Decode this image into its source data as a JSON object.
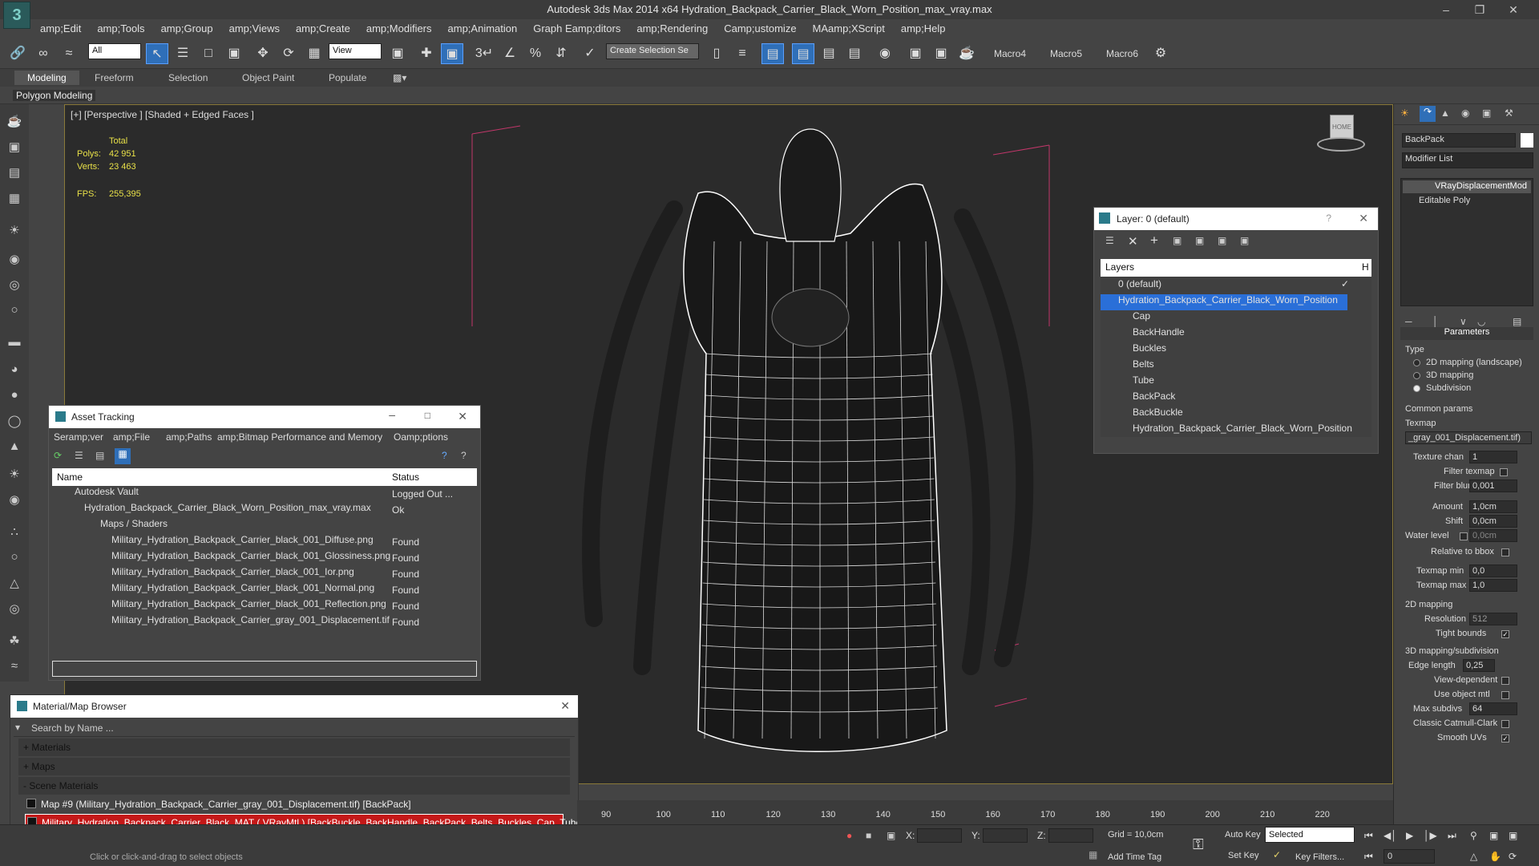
{
  "window": {
    "title": "Autodesk 3ds Max  2014 x64     Hydration_Backpack_Carrier_Black_Worn_Position_max_vray.max",
    "logo_icon": "3dsmax-logo-icon"
  },
  "menu": [
    "amp;Edit",
    "amp;Tools",
    "amp;Group",
    "amp;Views",
    "amp;Create",
    "amp;Modifiers",
    "amp;Animation",
    "Graph Eamp;ditors",
    "amp;Rendering",
    "Camp;ustomize",
    "MAamp;XScript",
    "amp;Help"
  ],
  "toolbar": {
    "filter_value": "All",
    "refcoord_value": "View",
    "named_selection_value": "Create Selection Se",
    "macros": [
      "Macro4",
      "Macro5",
      "Macro6"
    ]
  },
  "ribbon": {
    "tabs": [
      "Modeling",
      "Freeform",
      "Selection",
      "Object Paint",
      "Populate"
    ],
    "panel_label": "Polygon Modeling"
  },
  "viewport": {
    "label": "[+] [Perspective ] [Shaded + Edged Faces ]",
    "stats": {
      "total_label": "Total",
      "polys_label": "Polys:",
      "polys": "42 951",
      "verts_label": "Verts:",
      "verts": "23 463",
      "fps_label": "FPS:",
      "fps": "255,395"
    }
  },
  "layer_dialog": {
    "title": "Layer: 0 (default)",
    "column": "Layers",
    "column_h": "H",
    "rows": [
      {
        "label": "0 (default)"
      },
      {
        "label": "Hydration_Backpack_Carrier_Black_Worn_Position"
      },
      {
        "label": "Cap"
      },
      {
        "label": "BackHandle"
      },
      {
        "label": "Buckles"
      },
      {
        "label": "Belts"
      },
      {
        "label": "Tube"
      },
      {
        "label": "BackPack"
      },
      {
        "label": "BackBuckle"
      },
      {
        "label": "Hydration_Backpack_Carrier_Black_Worn_Position"
      }
    ]
  },
  "asset_tracking": {
    "title": "Asset Tracking",
    "menu": [
      "Seramp;ver",
      "amp;File",
      "amp;Paths",
      "amp;Bitmap Performance and Memory",
      "Oamp;ptions"
    ],
    "col_name": "Name",
    "col_status": "Status",
    "rows": [
      {
        "name": "Autodesk Vault",
        "status": "Logged Out ..."
      },
      {
        "name": "Hydration_Backpack_Carrier_Black_Worn_Position_max_vray.max",
        "status": "Ok"
      },
      {
        "name": "Maps / Shaders",
        "status": ""
      },
      {
        "name": "Military_Hydration_Backpack_Carrier_black_001_Diffuse.png",
        "status": "Found"
      },
      {
        "name": "Military_Hydration_Backpack_Carrier_black_001_Glossiness.png",
        "status": "Found"
      },
      {
        "name": "Military_Hydration_Backpack_Carrier_black_001_Ior.png",
        "status": "Found"
      },
      {
        "name": "Military_Hydration_Backpack_Carrier_black_001_Normal.png",
        "status": "Found"
      },
      {
        "name": "Military_Hydration_Backpack_Carrier_black_001_Reflection.png",
        "status": "Found"
      },
      {
        "name": "Military_Hydration_Backpack_Carrier_gray_001_Displacement.tif",
        "status": "Found"
      }
    ]
  },
  "material_browser": {
    "title": "Material/Map Browser",
    "search_placeholder": "Search by Name ...",
    "sections": [
      "+ Materials",
      "+ Maps",
      "- Scene Materials"
    ],
    "items": [
      "Map #9 (Military_Hydration_Backpack_Carrier_gray_001_Displacement.tif) [BackPack]",
      "Military_Hydration_Backpack_Carrier_Black_MAT  ( VRayMtl ) [BackBuckle, BackHandle, BackPack, Belts, Buckles, Cap, Tube]"
    ]
  },
  "command_panel": {
    "object_name": "BackPack",
    "modifier_list": "Modifier List",
    "stack": [
      "VRayDisplacementMod",
      "Editable Poly"
    ],
    "rollout_title": "Parameters",
    "type_label": "Type",
    "type_options": [
      "2D mapping (landscape)",
      "3D mapping",
      "Subdivision"
    ],
    "common_label": "Common params",
    "texmap_label": "Texmap",
    "texmap_value": "_gray_001_Displacement.tif)",
    "texture_chan_label": "Texture chan",
    "texture_chan": "1",
    "filter_texmap": "Filter texmap",
    "filter_blur_label": "Filter blur",
    "filter_blur": "0,001",
    "amount_label": "Amount",
    "amount": "1,0cm",
    "shift_label": "Shift",
    "shift": "0,0cm",
    "water_label": "Water level",
    "water": "0,0cm",
    "relative_bbox": "Relative to bbox",
    "texmap_min_label": "Texmap min",
    "texmap_min": "0,0",
    "texmap_max_label": "Texmap max",
    "texmap_max": "1,0",
    "section_2d": "2D mapping",
    "resolution_label": "Resolution",
    "resolution": "512",
    "tight_bounds": "Tight bounds",
    "section_3d": "3D mapping/subdivision",
    "edge_length_label": "Edge length",
    "edge_length": "0,25",
    "view_dependent": "View-dependent",
    "use_object_mtl": "Use object mtl",
    "max_subdivs_label": "Max subdivs",
    "max_subdivs": "64",
    "catmull": "Classic Catmull-Clark",
    "smooth_uvs": "Smooth UVs"
  },
  "timeline": {
    "ticks": [
      "90",
      "100",
      "110",
      "120",
      "130",
      "140",
      "150",
      "160",
      "170",
      "180",
      "190",
      "200",
      "210",
      "220"
    ]
  },
  "status": {
    "prompt": "Click or click-and-drag to select objects",
    "x_label": "X:",
    "y_label": "Y:",
    "z_label": "Z:",
    "grid": "Grid = 10,0cm",
    "add_time_tag": "Add Time Tag",
    "auto_key": "Auto Key",
    "set_key": "Set Key",
    "selected": "Selected",
    "key_filters": "Key Filters...",
    "frame": "0"
  }
}
